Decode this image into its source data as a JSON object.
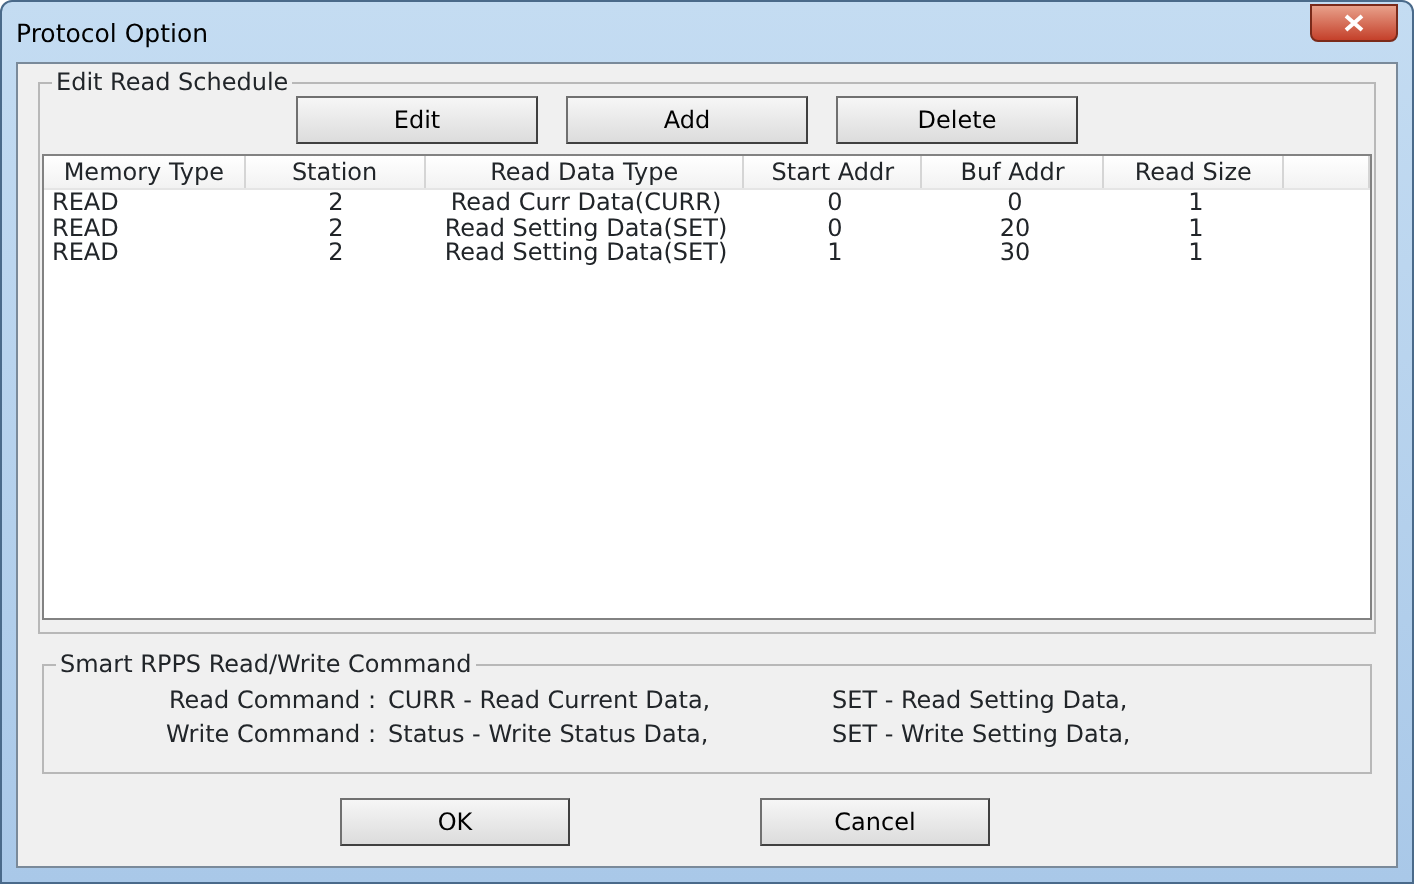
{
  "window": {
    "title": "Protocol Option"
  },
  "schedule": {
    "legend": "Edit Read Schedule",
    "buttons": [
      "Edit",
      "Add",
      "Delete"
    ],
    "columns": [
      "Memory Type",
      "Station",
      "Read Data Type",
      "Start Addr",
      "Buf Addr",
      "Read Size"
    ],
    "rows": [
      [
        "READ",
        "2",
        "Read Curr Data(CURR)",
        "0",
        "0",
        "1"
      ],
      [
        "READ",
        "2",
        "Read Setting Data(SET)",
        "0",
        "20",
        "1"
      ],
      [
        "READ",
        "2",
        "Read Setting Data(SET)",
        "1",
        "30",
        "1"
      ]
    ]
  },
  "commands": {
    "legend": "Smart RPPS Read/Write Command",
    "lines": [
      {
        "label": "Read Command :",
        "first": "CURR - Read Current Data,",
        "second": "SET - Read Setting Data,"
      },
      {
        "label": "Write Command :",
        "first": "Status - Write Status Data,",
        "second": "SET - Write Setting Data,"
      }
    ]
  },
  "buttons": [
    "OK",
    "Cancel"
  ]
}
